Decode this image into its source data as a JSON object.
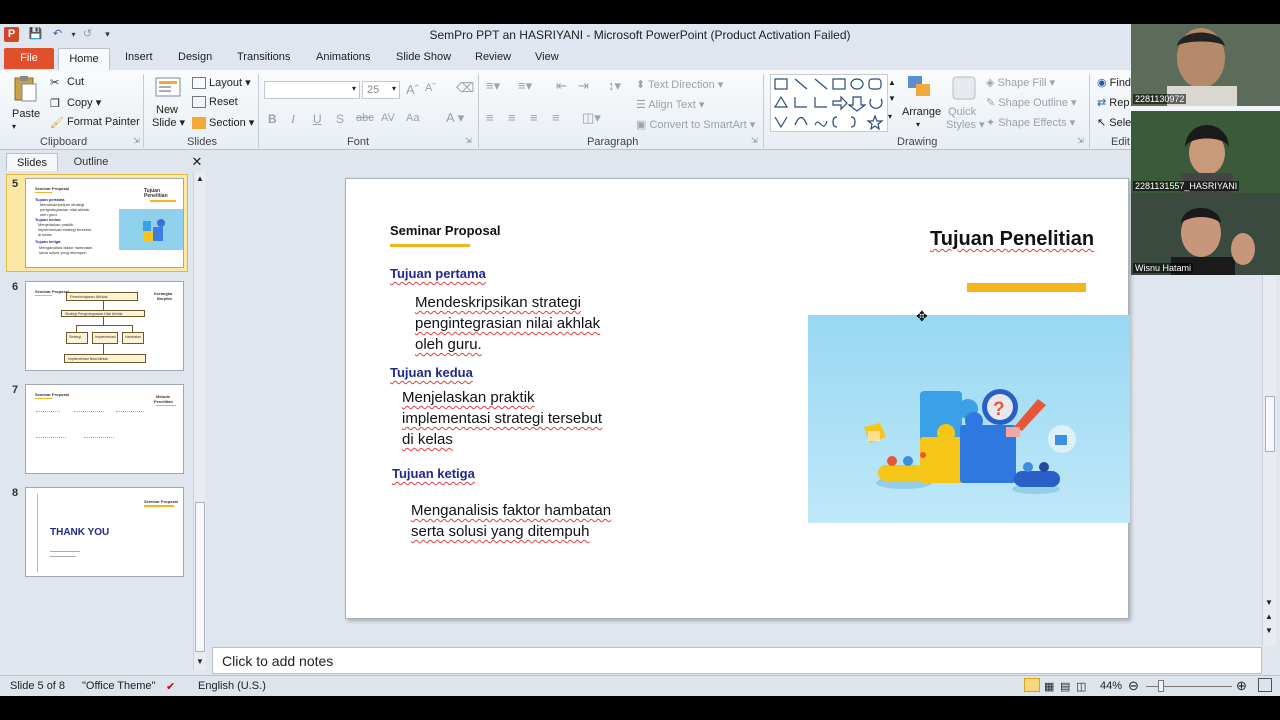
{
  "window": {
    "title": "SemPro PPT an HASRIYANI  -  Microsoft PowerPoint (Product Activation Failed)"
  },
  "tabs": [
    "File",
    "Home",
    "Insert",
    "Design",
    "Transitions",
    "Animations",
    "Slide Show",
    "Review",
    "View"
  ],
  "ribbon": {
    "clipboard": {
      "paste": "Paste",
      "cut": "Cut",
      "copy": "Copy",
      "format_painter": "Format Painter",
      "label": "Clipboard"
    },
    "slides": {
      "new_slide_1": "New",
      "new_slide_2": "Slide",
      "layout": "Layout",
      "reset": "Reset",
      "section": "Section",
      "label": "Slides"
    },
    "font": {
      "font_size": "25",
      "label": "Font"
    },
    "paragraph": {
      "text_direction": "Text Direction",
      "align_text": "Align Text",
      "convert_smartart": "Convert to SmartArt",
      "label": "Paragraph"
    },
    "drawing": {
      "arrange": "Arrange",
      "quick_styles_1": "Quick",
      "quick_styles_2": "Styles",
      "shape_fill": "Shape Fill",
      "shape_outline": "Shape Outline",
      "shape_effects": "Shape Effects",
      "label": "Drawing"
    },
    "editing": {
      "find": "Find",
      "replace": "Rep",
      "select": "Sele",
      "label": "Edit"
    }
  },
  "panel": {
    "slides_tab": "Slides",
    "outline_tab": "Outline"
  },
  "thumbnails": [
    {
      "num": "5",
      "header": "Seminar Proposal",
      "title": "Tujuan Penelitian",
      "l1": "Tujuan pertama",
      "l2": "Mendeskripsikan strategi",
      "l3": "pengintegrasian nilai akhlak",
      "l4": "oleh guru.",
      "l5": "Tujuan kedua",
      "l6": "Menjelaskan praktik",
      "l7": "implementasi strategi tersebut",
      "l8": "di kelas",
      "l9": "Tujuan ketiga",
      "l10": "Menganalisis faktor hambatan",
      "l11": "serta solusi yang ditempuh"
    },
    {
      "num": "6",
      "header": "Seminar Proposal",
      "title_1": "Kerangka",
      "title_2": "Berpikir",
      "box1": "Pembelajaran Akhlak",
      "box2": "Strategi Pengintegrasian Nilai Akhlak",
      "box3": "Strategi",
      "box4": "Implementasi",
      "box5": "Hambatan",
      "box6": "Implementasi Nilai Akhlak"
    },
    {
      "num": "7",
      "header": "Seminar Proposal",
      "title_1": "Metode",
      "title_2": "Penelitian"
    },
    {
      "num": "8",
      "header": "Seminar Proposal",
      "title": "THANK YOU"
    }
  ],
  "slide": {
    "header": "Seminar Proposal",
    "title": "Tujuan Penelitian",
    "sections": [
      {
        "heading": "Tujuan pertama",
        "lines": [
          "Mendeskripsikan strategi",
          "pengintegrasian nilai akhlak",
          "oleh guru."
        ]
      },
      {
        "heading": "Tujuan kedua",
        "lines": [
          "Menjelaskan praktik",
          "implementasi strategi tersebut",
          "di kelas"
        ]
      },
      {
        "heading": "Tujuan ketiga",
        "lines": [
          "Menganalisis faktor hambatan",
          "serta solusi yang ditempuh"
        ]
      }
    ]
  },
  "notes": {
    "placeholder": "Click to add notes"
  },
  "status": {
    "slide": "Slide 5 of 8",
    "theme": "\"Office Theme\"",
    "language": "English (U.S.)",
    "zoom": "44%"
  },
  "participants": [
    {
      "name": "2281130972"
    },
    {
      "name": "2281131557_HASRIYANI"
    },
    {
      "name": "Wisnu Hatami"
    }
  ],
  "colors": {
    "accent_yellow": "#f6b51e",
    "heading_blue": "#1f2a8c",
    "file_tab": "#e0502b"
  }
}
